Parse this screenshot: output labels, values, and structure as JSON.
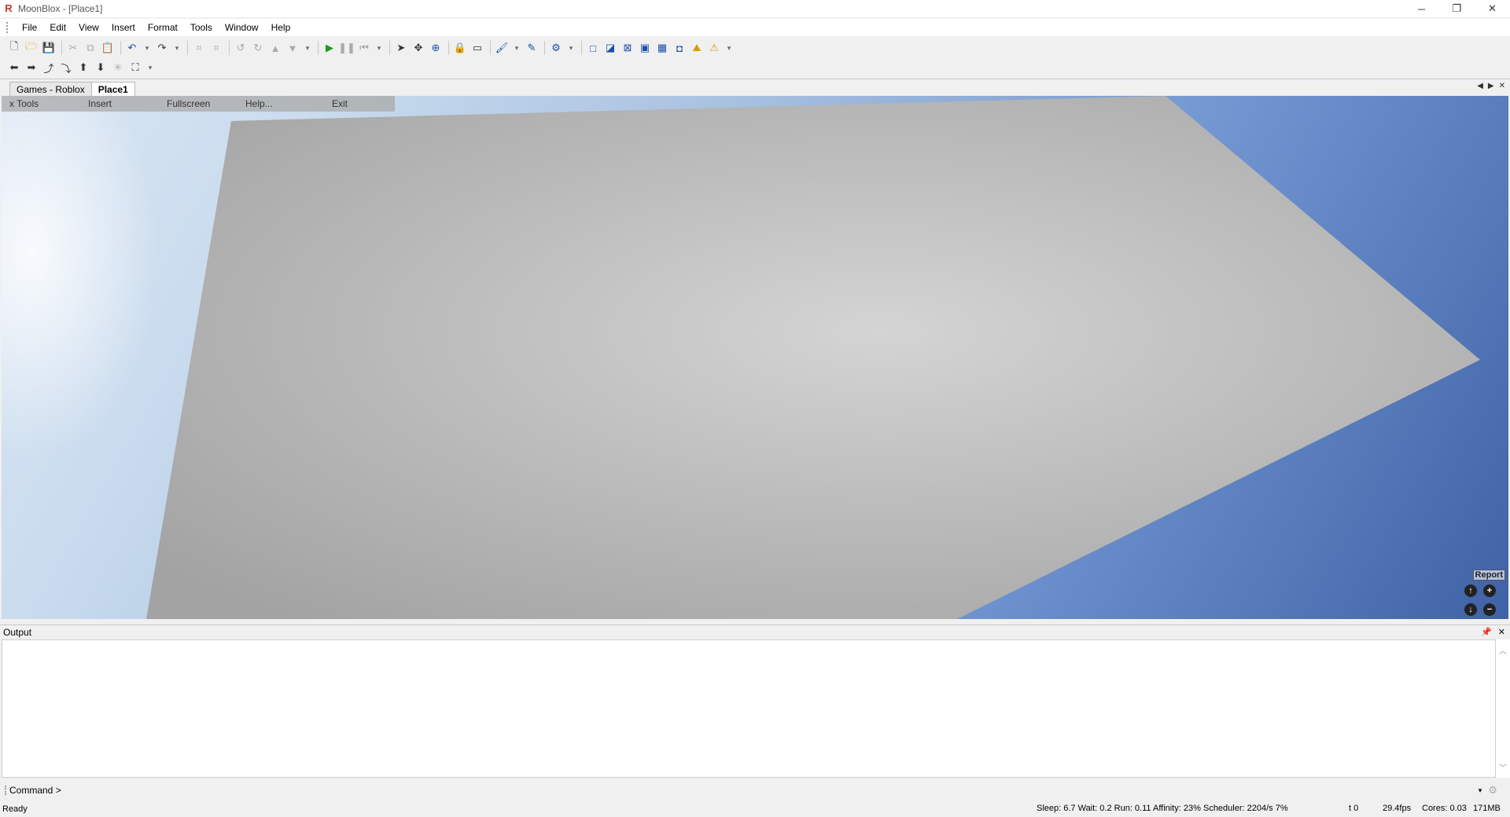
{
  "window": {
    "title": "MoonBlox - [Place1]",
    "controls": {
      "minimize": "─",
      "restore": "❐",
      "close": "✕"
    }
  },
  "menubar": {
    "items": [
      "File",
      "Edit",
      "View",
      "Insert",
      "Format",
      "Tools",
      "Window",
      "Help"
    ]
  },
  "tabs": {
    "items": [
      "Games - Roblox",
      "Place1"
    ],
    "active": "Place1"
  },
  "viewport": {
    "overlay_menu": [
      "x Tools",
      "Insert",
      "Fullscreen",
      "Help...",
      "Exit"
    ],
    "report_label": "Report",
    "sky_colors": [
      "#dbe7f3",
      "#3f62a6"
    ],
    "baseplate_color": "#b9b9b9"
  },
  "output": {
    "title": "Output",
    "content": ""
  },
  "command": {
    "label": "Command >",
    "value": ""
  },
  "status": {
    "ready": "Ready",
    "perf": "Sleep: 6.7 Wait: 0.2 Run: 0.11 Affinity: 23% Scheduler: 2204/s 7%",
    "t": "t 0",
    "fps": "29.4fps",
    "cores": "Cores: 0.03",
    "memory": "171MB"
  }
}
